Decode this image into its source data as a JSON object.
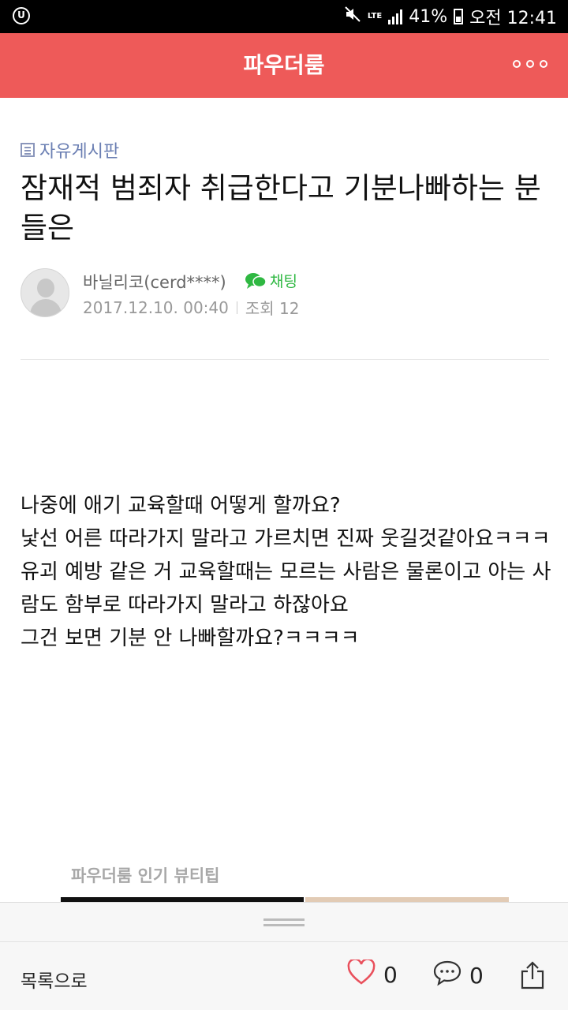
{
  "status_bar": {
    "battery": "41%",
    "time": "오전 12:41",
    "network": "LTE",
    "carrier_logo": "U"
  },
  "header": {
    "title": "파우더룸"
  },
  "post": {
    "board": "자유게시판",
    "title": "잠재적 범죄자 취급한다고 기분나빠하는 분들은",
    "author": "바닐리코(cerd****)",
    "chat_label": "채팅",
    "date": "2017.12.10. 00:40",
    "views": "조회 12",
    "content": [
      "나중에 애기 교육할때 어떻게 할까요?",
      "낯선 어른 따라가지 말라고 가르치면 진짜 웃길것같아요ㅋㅋㅋ",
      "유괴 예방 같은 거 교육할때는 모르는 사람은 물론이고 아는 사람도 함부로 따라가지 말라고 하잖아요",
      "그건 보면 기분 안 나빠할까요?ㅋㅋㅋㅋ"
    ]
  },
  "popular": {
    "label": "파우더룸 인기 뷰티팁"
  },
  "bottom_bar": {
    "back_label": "목록으로",
    "likes": "0",
    "comments": "0"
  },
  "colors": {
    "header": "#ee5a59",
    "board": "#6b7fb3",
    "chat": "#2fb842",
    "like_icon": "#e9505c"
  }
}
